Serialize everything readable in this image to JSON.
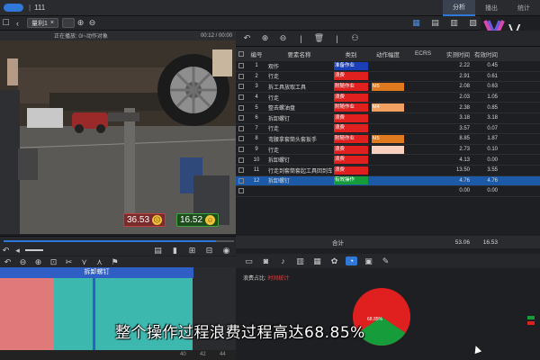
{
  "titlebar": {
    "sep": "|",
    "title": "111"
  },
  "top_tabs": [
    {
      "label": "分析",
      "active": true
    },
    {
      "label": "播出",
      "active": false
    },
    {
      "label": "统计",
      "active": false
    }
  ],
  "logo": {
    "letter": "V",
    "sub": "信"
  },
  "toolbar": {
    "tab_label": "量利1",
    "close": "×"
  },
  "video": {
    "header_left": "正在播放: 0/~动作对象",
    "header_right": "00:12 / 00:00",
    "badge_waste": "36.53",
    "badge_value": "16.52"
  },
  "gantt": {
    "label": "拆卸螺钉",
    "ticks": [
      "40",
      "42",
      "44"
    ]
  },
  "table": {
    "headers": [
      "编号",
      "要素名称",
      "类别",
      "动作幅度",
      "ECRS",
      "实测时间",
      "有效时间"
    ],
    "rows": [
      {
        "no": "1",
        "name": "观作",
        "type": "准备作业",
        "type_color": "#1a3fb8",
        "lvl": "",
        "lvl_color": "",
        "act": "2.22",
        "eff": "0.45"
      },
      {
        "no": "2",
        "name": "行走",
        "type": "浪费",
        "type_color": "#e01f1f",
        "lvl": "",
        "lvl_color": "",
        "act": "2.91",
        "eff": "0.61"
      },
      {
        "no": "3",
        "name": "拆工具放取工具",
        "type": "附随作业",
        "type_color": "#e01f1f",
        "lvl": "M5",
        "lvl_color": "#e07a1f",
        "act": "2.08",
        "eff": "0.63"
      },
      {
        "no": "4",
        "name": "行走",
        "type": "浪费",
        "type_color": "#e01f1f",
        "lvl": "",
        "lvl_color": "",
        "act": "2.03",
        "eff": "1.05"
      },
      {
        "no": "5",
        "name": "整去螺油盘",
        "type": "附随作业",
        "type_color": "#e01f1f",
        "lvl": "M4",
        "lvl_color": "#f0a060",
        "act": "2.38",
        "eff": "0.85"
      },
      {
        "no": "6",
        "name": "拆卸螺钉",
        "type": "浪费",
        "type_color": "#e01f1f",
        "lvl": "",
        "lvl_color": "",
        "act": "3.18",
        "eff": "3.18"
      },
      {
        "no": "7",
        "name": "行走",
        "type": "浪费",
        "type_color": "#e01f1f",
        "lvl": "",
        "lvl_color": "",
        "act": "3.57",
        "eff": "0.07"
      },
      {
        "no": "8",
        "name": "弯腰拿套筒头套扳手",
        "type": "附随作业",
        "type_color": "#e01f1f",
        "lvl": "M5",
        "lvl_color": "#e07a1f",
        "act": "8.85",
        "eff": "1.87"
      },
      {
        "no": "9",
        "name": "行走",
        "type": "浪费",
        "type_color": "#e01f1f",
        "lvl": "",
        "lvl_color": "#f7d0c0",
        "act": "2.73",
        "eff": "0.10"
      },
      {
        "no": "10",
        "name": "拆卸螺钉",
        "type": "浪费",
        "type_color": "#e01f1f",
        "lvl": "",
        "lvl_color": "",
        "act": "4.13",
        "eff": "0.00"
      },
      {
        "no": "11",
        "name": "行走到套筒套起工具回到车身旁",
        "type": "浪费",
        "type_color": "#e01f1f",
        "lvl": "",
        "lvl_color": "",
        "act": "13.50",
        "eff": "3.55"
      },
      {
        "no": "12",
        "name": "拆卸螺钉",
        "type": "有效操作",
        "type_color": "#169c3a",
        "lvl": "",
        "lvl_color": "",
        "act": "4.76",
        "eff": "4.76"
      }
    ],
    "extra_row": {
      "act": "0.00",
      "eff": "0.00"
    },
    "total_label": "合计",
    "total_act": "53.06",
    "total_eff": "16.53"
  },
  "analysis": {
    "label": "浪费占比:",
    "label_red": "时间统计",
    "pie_text": "68.85%",
    "pie_waste_pct": 68.85,
    "colors": {
      "waste": "#e01f1f",
      "value": "#169c3a"
    }
  },
  "subtitle": "整个操作过程浪费过程高达68.85%"
}
